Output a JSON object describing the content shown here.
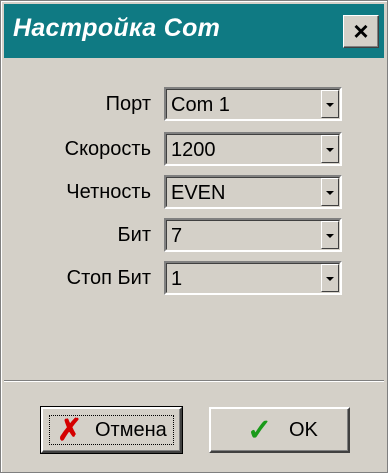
{
  "window": {
    "title": "Настройка Com",
    "close_label": "✕"
  },
  "fields": [
    {
      "label": "Порт",
      "value": "Com 1"
    },
    {
      "label": "Скорость",
      "value": "1200"
    },
    {
      "label": "Четность",
      "value": "EVEN"
    },
    {
      "label": "Бит",
      "value": "7"
    },
    {
      "label": "Стоп Бит",
      "value": "1"
    }
  ],
  "buttons": {
    "cancel_label": "Отмена",
    "ok_label": "OK",
    "cancel_icon": "x-icon",
    "ok_icon": "checkmark-icon"
  },
  "colors": {
    "titlebar": "#0f7a83",
    "cancel_icon": "#d40000",
    "ok_icon": "#1a9a1a"
  }
}
